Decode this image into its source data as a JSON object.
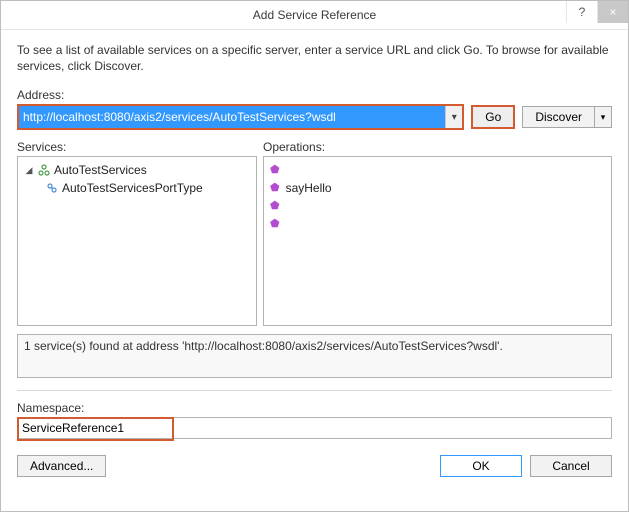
{
  "window": {
    "title": "Add Service Reference",
    "help_glyph": "?",
    "close_glyph": "×"
  },
  "instructions": "To see a list of available services on a specific server, enter a service URL and click Go. To browse for available services, click Discover.",
  "address": {
    "label": "Address:",
    "value": "http://localhost:8080/axis2/services/AutoTestServices?wsdl",
    "go_label": "Go",
    "discover_label": "Discover",
    "dropdown_glyph": "▾"
  },
  "services": {
    "label": "Services:",
    "tree": {
      "root": "AutoTestServices",
      "child": "AutoTestServicesPortType",
      "twisty": "�△"
    }
  },
  "operations": {
    "label": "Operations:",
    "items": [
      "",
      "sayHello",
      "",
      ""
    ]
  },
  "status": "1 service(s) found at address 'http://localhost:8080/axis2/services/AutoTestServices?wsdl'.",
  "namespace": {
    "label": "Namespace:",
    "value": "ServiceReference1"
  },
  "footer": {
    "advanced": "Advanced...",
    "ok": "OK",
    "cancel": "Cancel"
  }
}
